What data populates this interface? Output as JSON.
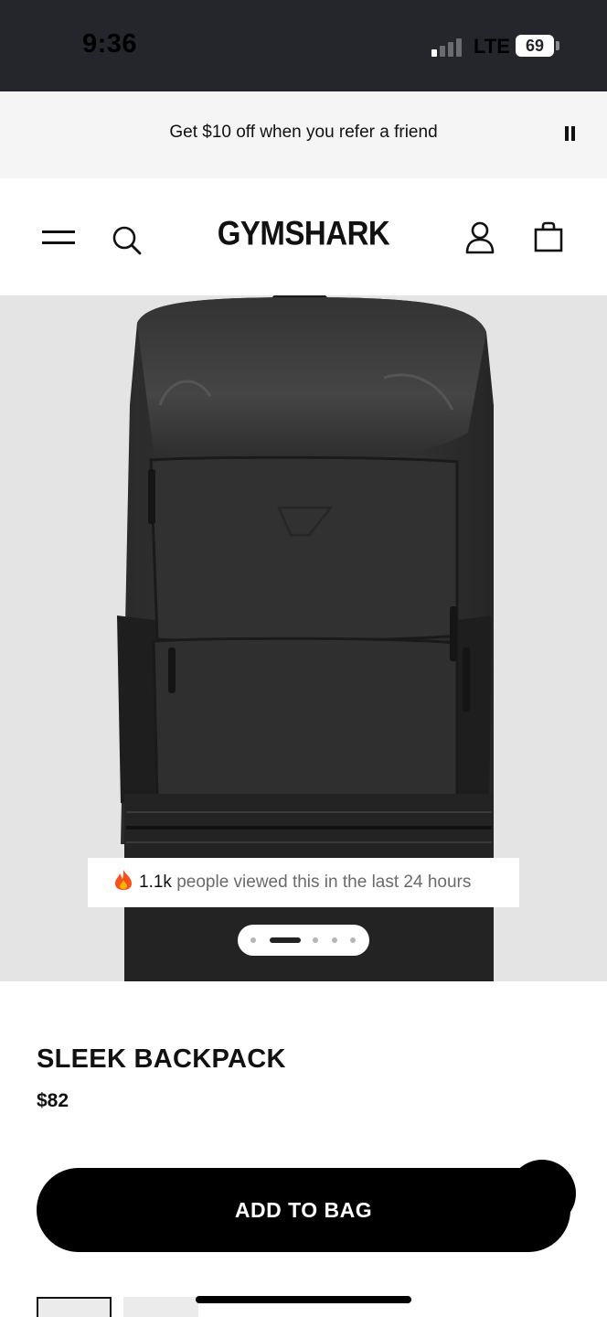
{
  "status_bar": {
    "time": "9:36",
    "network": "LTE",
    "battery": "69"
  },
  "promo": {
    "text": "Get $10 off when you refer a friend",
    "icon": "pause-icon"
  },
  "header": {
    "logo": "GYMSHARK",
    "icons": [
      "menu-icon",
      "search-icon",
      "account-icon",
      "bag-icon"
    ]
  },
  "gallery": {
    "views_count": "1.1k",
    "views_text": "people viewed this in the last 24 hours",
    "slide_count": 5,
    "active_slide": 2
  },
  "product": {
    "title": "SLEEK BACKPACK",
    "price": "$82",
    "add_button": "ADD TO BAG"
  }
}
